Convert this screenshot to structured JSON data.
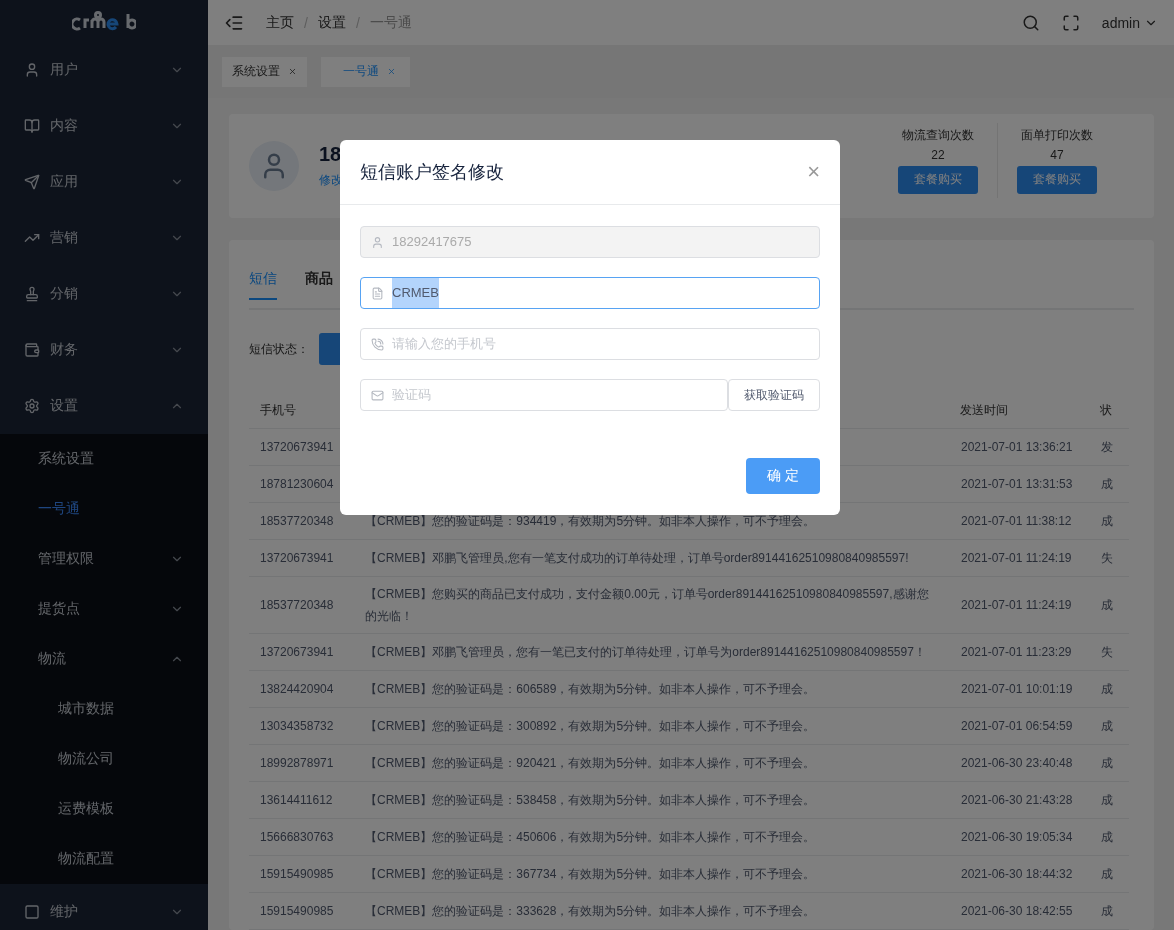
{
  "sidebar": {
    "items": [
      {
        "label": "用户",
        "expanded": false
      },
      {
        "label": "内容",
        "expanded": false
      },
      {
        "label": "应用",
        "expanded": false
      },
      {
        "label": "营销",
        "expanded": false
      },
      {
        "label": "分销",
        "expanded": false
      },
      {
        "label": "财务",
        "expanded": false
      },
      {
        "label": "设置",
        "expanded": true,
        "children": [
          {
            "label": "系统设置",
            "selected": false
          },
          {
            "label": "一号通",
            "selected": true
          },
          {
            "label": "管理权限",
            "selected": false,
            "expanded": false
          },
          {
            "label": "提货点",
            "selected": false,
            "expanded": false
          },
          {
            "label": "物流",
            "selected": false,
            "expanded": true,
            "children": [
              {
                "label": "城市数据",
                "selected": false
              },
              {
                "label": "物流公司",
                "selected": false
              },
              {
                "label": "运费模板",
                "selected": false
              },
              {
                "label": "物流配置",
                "selected": false
              }
            ]
          }
        ]
      },
      {
        "label": "维护",
        "expanded": false
      }
    ]
  },
  "breadcrumb": {
    "separator": "/",
    "items": [
      "主页",
      "设置",
      "一号通"
    ]
  },
  "user": "admin",
  "tags": [
    {
      "label": "系统设置",
      "selected": false
    },
    {
      "label": "一号通",
      "selected": true
    }
  ],
  "account": {
    "name": "18",
    "link": "修改"
  },
  "stats": [
    {
      "label": "物流查询次数",
      "count": "22",
      "button": "套餐购买"
    },
    {
      "label": "面单打印次数",
      "count": "47",
      "button": "套餐购买"
    }
  ],
  "tabs": [
    {
      "label": "短信",
      "selected": true
    },
    {
      "label": "商品",
      "selected": false
    }
  ],
  "filter": {
    "label": "短信状态："
  },
  "table": {
    "columns": [
      "手机号",
      "发送时间",
      "状"
    ],
    "rows": [
      {
        "phone": "13720673941",
        "time": "2021-07-01 13:36:21",
        "status": "发"
      },
      {
        "phone": "18781230604",
        "time": "2021-07-01 13:31:53",
        "status": "成"
      },
      {
        "phone": "18537720348",
        "content": "【CRMEB】您的验证码是：934419，有效期为5分钟。如非本人操作，可不予理会。",
        "time": "2021-07-01 11:38:12",
        "status": "成"
      },
      {
        "phone": "13720673941",
        "content": "【CRMEB】邓鹏飞管理员,您有一笔支付成功的订单待处理，订单号order89144162510980840985597!",
        "time": "2021-07-01 11:24:19",
        "status": "失"
      },
      {
        "phone": "18537720348",
        "content": "【CRMEB】您购买的商品已支付成功，支付金额0.00元，订单号order89144162510980840985597,感谢您的光临！",
        "time": "2021-07-01 11:24:19",
        "status": "成"
      },
      {
        "phone": "13720673941",
        "content": "【CRMEB】邓鹏飞管理员，您有一笔已支付的订单待处理，订单号为order89144162510980840985597！",
        "time": "2021-07-01 11:23:29",
        "status": "失"
      },
      {
        "phone": "13824420904",
        "content": "【CRMEB】您的验证码是：606589，有效期为5分钟。如非本人操作，可不予理会。",
        "time": "2021-07-01 10:01:19",
        "status": "成"
      },
      {
        "phone": "13034358732",
        "content": "【CRMEB】您的验证码是：300892，有效期为5分钟。如非本人操作，可不予理会。",
        "time": "2021-07-01 06:54:59",
        "status": "成"
      },
      {
        "phone": "18992878971",
        "content": "【CRMEB】您的验证码是：920421，有效期为5分钟。如非本人操作，可不予理会。",
        "time": "2021-06-30 23:40:48",
        "status": "成"
      },
      {
        "phone": "13614411612",
        "content": "【CRMEB】您的验证码是：538458，有效期为5分钟。如非本人操作，可不予理会。",
        "time": "2021-06-30 21:43:28",
        "status": "成"
      },
      {
        "phone": "15666830763",
        "content": "【CRMEB】您的验证码是：450606，有效期为5分钟。如非本人操作，可不予理会。",
        "time": "2021-06-30 19:05:34",
        "status": "成"
      },
      {
        "phone": "15915490985",
        "content": "【CRMEB】您的验证码是：367734，有效期为5分钟。如非本人操作，可不予理会。",
        "time": "2021-06-30 18:44:32",
        "status": "成"
      },
      {
        "phone": "15915490985",
        "content": "【CRMEB】您的验证码是：333628，有效期为5分钟。如非本人操作，可不予理会。",
        "time": "2021-06-30 18:42:55",
        "status": "成"
      }
    ]
  },
  "modal": {
    "title": "短信账户签名修改",
    "close": "×",
    "fields": [
      {
        "kind": "text",
        "value": "18292417675",
        "disabled": true,
        "focused": false
      },
      {
        "kind": "text",
        "value": "CRMEB",
        "disabled": false,
        "focused": true
      },
      {
        "kind": "text",
        "placeholder": "请输入您的手机号",
        "disabled": false,
        "focused": false
      },
      {
        "kind": "code",
        "placeholder": "验证码",
        "button": "获取验证码",
        "disabled": false,
        "focused": false
      }
    ],
    "submit": "确 定"
  }
}
